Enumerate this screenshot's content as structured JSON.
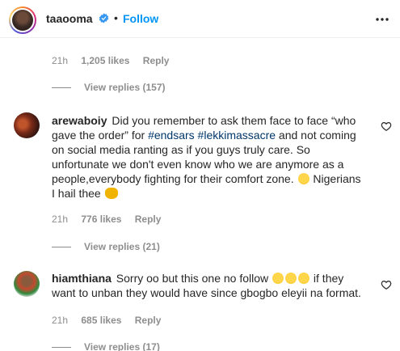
{
  "header": {
    "username": "taaooma",
    "separator": "•",
    "follow_label": "Follow"
  },
  "top_meta": {
    "time": "21h",
    "likes": "1,205 likes",
    "reply": "Reply"
  },
  "top_view_replies": "View replies (157)",
  "comments": [
    {
      "username": "arewaboiy",
      "text_1": "Did you remember to ask them face to face “who gave the order” for ",
      "hashtag_1": "#endsars",
      "hashtag_2": "#lekkimassacre",
      "text_2": " and not coming on social media ranting as if you guys truly care. So unfortunate we don't even know who we are anymore as a people,everybody fighting for their comfort zone. ",
      "text_3": " Nigerians I hail thee ",
      "time": "21h",
      "likes": "776 likes",
      "reply": "Reply",
      "view_replies": "View replies (21)"
    },
    {
      "username": "hiamthiana",
      "text_1": "Sorry oo but this one no follow ",
      "text_2": " if they want to unban they would have since gbogbo eleyii na format.",
      "time": "21h",
      "likes": "685 likes",
      "reply": "Reply",
      "view_replies": "View replies (17)"
    }
  ],
  "icons": {
    "verified": "verified-badge-icon",
    "more": "more-options-icon",
    "heart": "heart-outline-icon",
    "emoji_sad": "sad-face-emoji",
    "emoji_clap": "clapping-hands-emoji",
    "emoji_laugh": "laughing-tears-emoji"
  },
  "colors": {
    "link_blue": "#0095f6",
    "hashtag": "#00376b",
    "muted": "#8e8e8e",
    "text": "#262626"
  }
}
